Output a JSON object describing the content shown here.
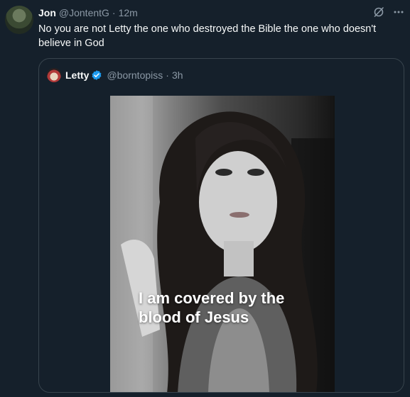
{
  "tweet": {
    "author_name": "Jon",
    "author_handle": "@JontentG",
    "separator": "·",
    "time": "12m",
    "text": "No you are not Letty the one who destroyed the Bible the one who doesn't believe in God"
  },
  "quoted": {
    "author_name": "Letty",
    "author_handle": "@borntopiss",
    "separator": "·",
    "time": "3h",
    "image_caption": "I am covered by the blood of Jesus"
  },
  "icons": {
    "grok": "grok-icon",
    "more": "more-icon",
    "verified": "verified-badge-icon"
  },
  "colors": {
    "background": "#15202b",
    "text": "#f7f9f9",
    "secondary_text": "#8b98a5",
    "border": "#38444d",
    "verified": "#1d9bf0"
  }
}
